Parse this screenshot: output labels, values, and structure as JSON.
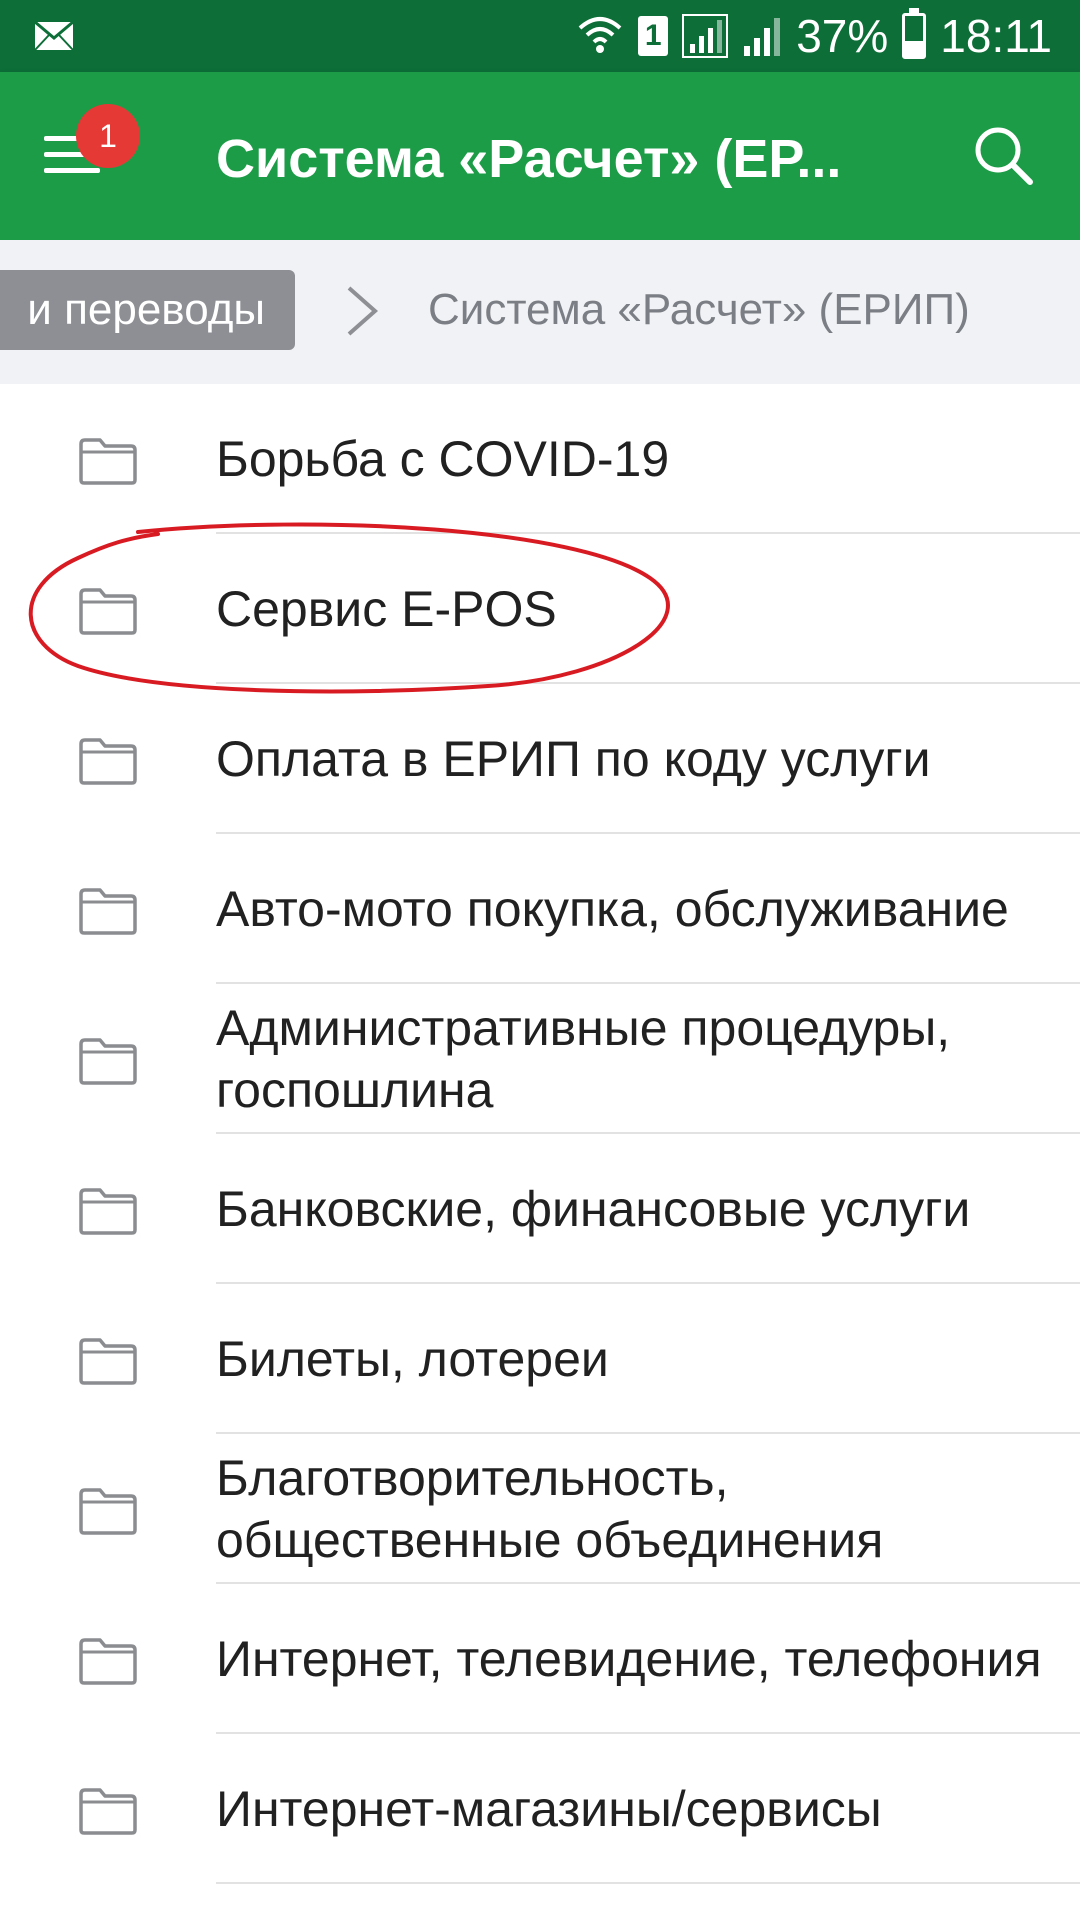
{
  "status_bar": {
    "battery": "37%",
    "time": "18:11",
    "sim_slot": "1",
    "icons": [
      "mail-icon",
      "wifi-icon",
      "sim-icon",
      "signal-icon",
      "signal-icon",
      "battery-icon"
    ]
  },
  "app_bar": {
    "title": "Система «Расчет» (ЕР...",
    "notification_count": "1",
    "menu_icon": "hamburger-menu-icon",
    "search_icon": "search-icon",
    "background_color": "#1d9c48"
  },
  "breadcrumb": {
    "parent": "и переводы",
    "current": "Система «Расчет» (ЕРИП)"
  },
  "list": {
    "items": [
      {
        "label": "Борьба с COVID-19",
        "icon": "folder-icon"
      },
      {
        "label": "Сервис E-POS",
        "icon": "folder-icon",
        "highlighted": true
      },
      {
        "label": "Оплата в ЕРИП по коду услуги",
        "icon": "folder-icon"
      },
      {
        "label": "Авто-мото покупка, обслуживание",
        "icon": "folder-icon"
      },
      {
        "label": "Административные процедуры, госпошлина",
        "icon": "folder-icon"
      },
      {
        "label": "Банковские, финансовые услуги",
        "icon": "folder-icon"
      },
      {
        "label": "Билеты, лотереи",
        "icon": "folder-icon"
      },
      {
        "label": "Благотворительность, общественные объединения",
        "icon": "folder-icon"
      },
      {
        "label": "Интернет, телевидение, телефония",
        "icon": "folder-icon"
      },
      {
        "label": "Интернет-магазины/сервисы",
        "icon": "folder-icon"
      }
    ]
  },
  "annotation": {
    "color": "#d81b23",
    "shape": "ellipse"
  }
}
